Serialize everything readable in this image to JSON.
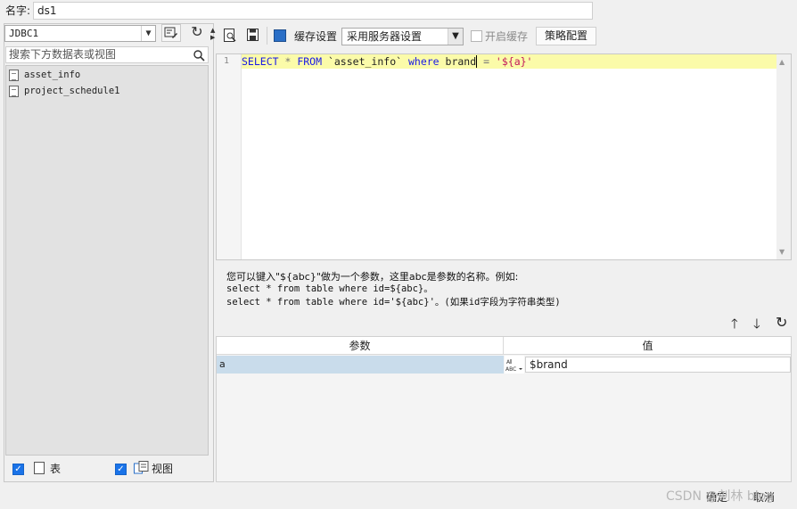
{
  "dialog": {
    "name_label": "名字:",
    "name_value": "ds1"
  },
  "left_panel": {
    "connection": "JDBC1",
    "search_placeholder": "搜索下方数据表或视图",
    "tables": [
      "asset_info",
      "project_schedule1"
    ],
    "filters": [
      {
        "label": "表",
        "checked": true
      },
      {
        "label": "视图",
        "checked": true
      }
    ]
  },
  "toolbar": {
    "cache_label": "缓存设置",
    "server_select": "采用服务器设置",
    "enable_cache_label": "开启缓存",
    "enable_cache_checked": false,
    "strategy_label": "策略配置"
  },
  "editor": {
    "line_number": "1",
    "sql_tokens": [
      {
        "t": "SELECT",
        "c": "kw"
      },
      {
        "t": " * ",
        "c": "op"
      },
      {
        "t": "FROM",
        "c": "kw"
      },
      {
        "t": " `asset_info` ",
        "c": "txt"
      },
      {
        "t": "where",
        "c": "kw"
      },
      {
        "t": " brand",
        "c": "txt"
      },
      {
        "t": " = ",
        "c": "op"
      },
      {
        "t": "'${a}'",
        "c": "str"
      }
    ]
  },
  "hint": {
    "line1": "您可以键入\"${abc}\"做为一个参数，这里abc是参数的名称。例如:",
    "line2": "select * from table where id=${abc}。",
    "line3": "select * from table where id='${abc}'。(如果id字段为字符串类型)"
  },
  "params": {
    "col_param": "参数",
    "col_value": "值",
    "rows": [
      {
        "name": "a",
        "type_icon": "ABC",
        "value": "$brand"
      }
    ]
  },
  "footer": {
    "ok_label": "确定",
    "cancel_label": "取消",
    "watermark": "CSDN @刘林 blog"
  },
  "colors": {
    "editor_highlight": "#fbfba9",
    "keyword": "#1a1ae6",
    "string": "#c2185b",
    "checkbox": "#1a73e8",
    "param_row": "#c9dceb"
  }
}
